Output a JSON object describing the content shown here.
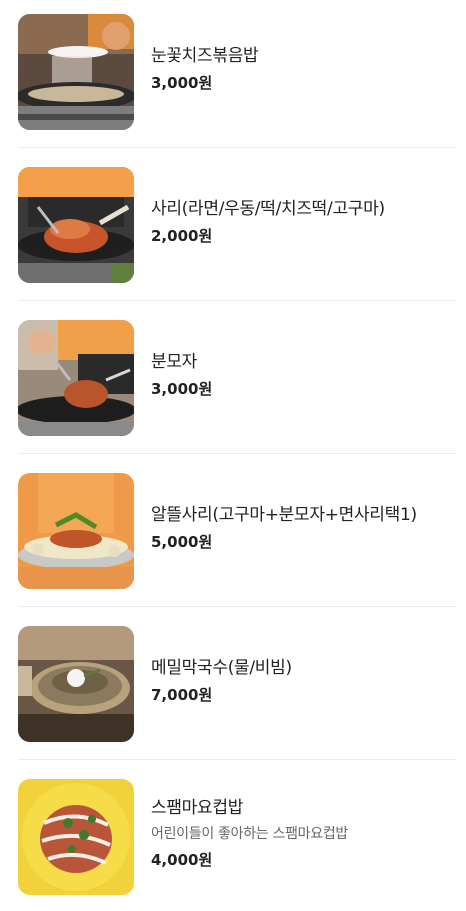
{
  "menu": {
    "items": [
      {
        "name": "눈꽃치즈볶음밥",
        "price": "3,000원",
        "photo": "cheese-fried-rice-photo"
      },
      {
        "name": "사리(라면/우동/떡/치즈떡/고구마)",
        "price": "2,000원",
        "photo": "sari-noodles-photo"
      },
      {
        "name": "분모자",
        "price": "3,000원",
        "photo": "bunmoja-photo"
      },
      {
        "name": "알뜰사리(고구마+분모자+면사리택1)",
        "price": "5,000원",
        "photo": "value-sari-platter-photo"
      },
      {
        "name": "메밀막국수(물/비빔)",
        "price": "7,000원",
        "photo": "buckwheat-noodles-photo"
      },
      {
        "name": "스팸마요컵밥",
        "description": "어린이들이 좋아하는 스팸마요컵밥",
        "price": "4,000원",
        "photo": "spam-mayo-cupbap-photo"
      }
    ]
  },
  "colors": {
    "divider": "#ececec",
    "text": "#222222",
    "description": "#666666"
  }
}
